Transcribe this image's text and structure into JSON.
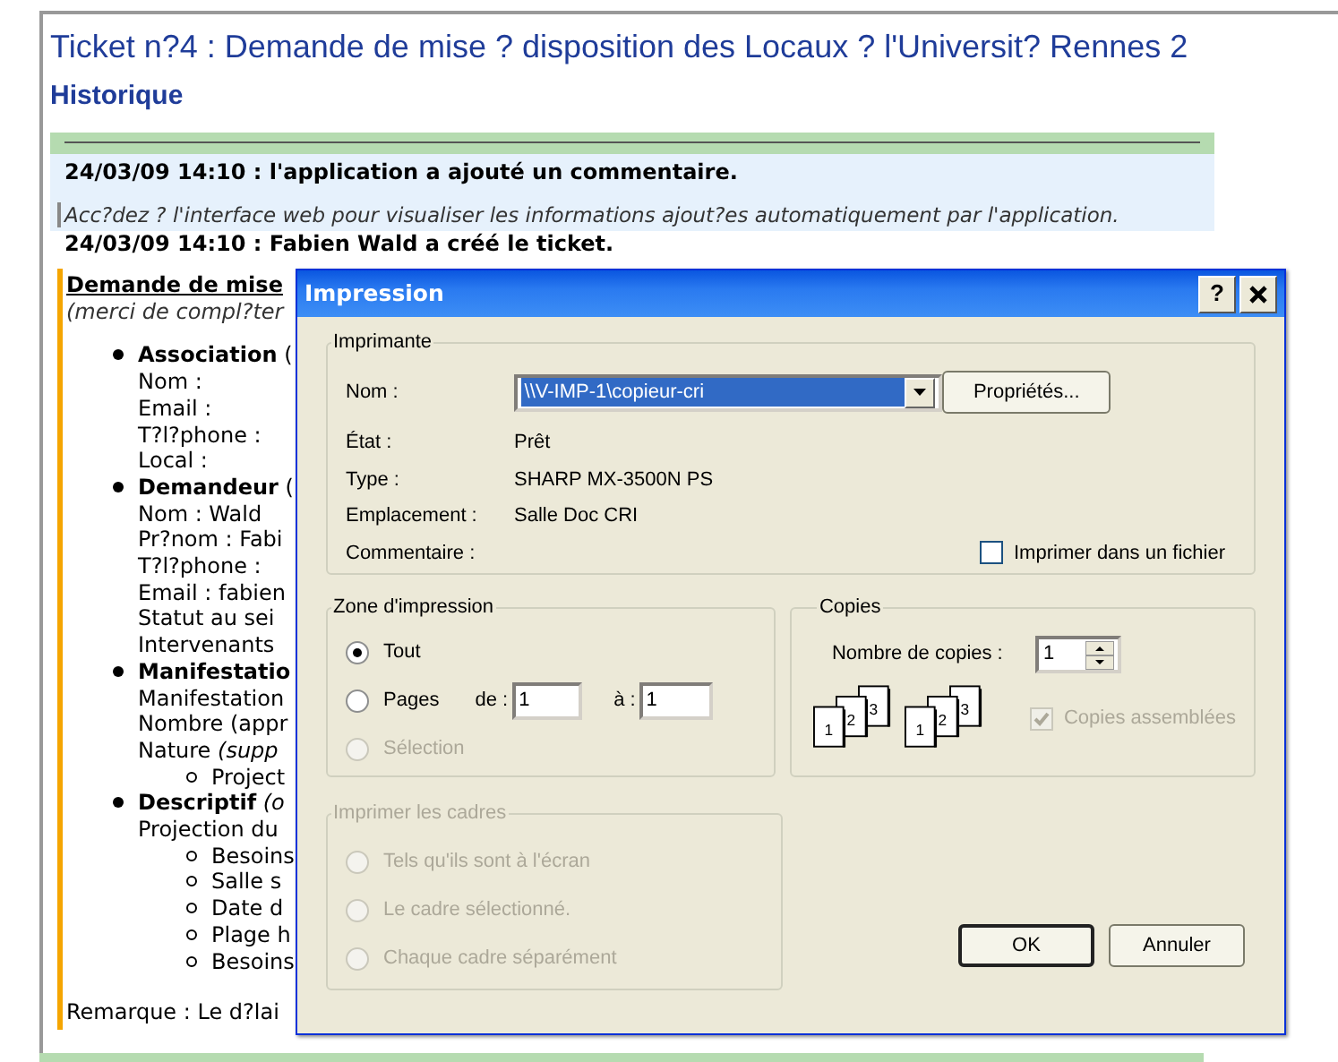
{
  "page": {
    "title": "Ticket n?4 : Demande de mise ? disposition des Locaux ? l'Universit? Rennes 2",
    "section": "Historique",
    "entries": [
      {
        "kind": "comment",
        "heading": "24/03/09 14:10 : l'application a ajouté un commentaire.",
        "text": "Acc?dez ? l'interface web pour visualiser les informations ajout?es automatiquement par l'application."
      },
      {
        "kind": "event",
        "heading": "24/03/09 14:10 : Fabien Wald a créé le ticket."
      }
    ],
    "form": {
      "heading": "Demande de mise",
      "note": "(merci de compl?ter",
      "items": [
        {
          "label": "**Association** (",
          "lines": [
            "Nom :",
            "Email :",
            "T?l?phone :",
            "Local :"
          ]
        },
        {
          "label": "**Demandeur** (",
          "lines": [
            "Nom : Wald",
            "Pr?nom : Fabi",
            "T?l?phone :",
            "Email : fabien",
            "Statut au sei",
            "Intervenants"
          ]
        },
        {
          "label": "**Manifestatio**",
          "lines": [
            "Manifestation",
            "Nombre (appr",
            "Nature *(supp*"
          ],
          "subitems": [
            "Project"
          ]
        },
        {
          "label": "**Descriptif** *(o*",
          "lines": [
            "Projection du"
          ],
          "subitems": [
            "Besoins",
            "Salle s",
            "Date d",
            "Plage h",
            "Besoins"
          ]
        }
      ],
      "remark": "Remarque : Le d?lai"
    }
  },
  "dialog": {
    "title": "Impression",
    "help": "?",
    "printer": {
      "legend": "Imprimante",
      "name_label": "Nom :",
      "name_value": "\\\\V-IMP-1\\copieur-cri",
      "properties_button": "Propriétés...",
      "details": [
        {
          "label": "État :",
          "value": "Prêt"
        },
        {
          "label": "Type :",
          "value": "SHARP MX-3500N PS"
        },
        {
          "label": "Emplacement :",
          "value": "Salle Doc CRI"
        },
        {
          "label": "Commentaire :"
        }
      ],
      "print_to_file": {
        "label": "Imprimer dans un fichier",
        "checked": false
      }
    },
    "range": {
      "legend": "Zone d'impression",
      "options": [
        {
          "label": "Tout",
          "selected": true,
          "disabled": false
        },
        {
          "label": "Pages",
          "selected": false,
          "disabled": false
        },
        {
          "label": "Sélection",
          "selected": false,
          "disabled": true
        }
      ],
      "from_label": "de :",
      "from_value": "1",
      "to_label": "à :",
      "to_value": "1"
    },
    "copies": {
      "legend": "Copies",
      "count_label": "Nombre de copies :",
      "count_value": "1",
      "illustrations": [
        [
          "1",
          "2",
          "3"
        ],
        [
          "1",
          "2",
          "3"
        ]
      ],
      "collate": {
        "label": "Copies assemblées",
        "checked": true,
        "disabled": true
      }
    },
    "frames": {
      "legend": "Imprimer les cadres",
      "disabled": true,
      "options": [
        {
          "label": "Tels qu'ils sont à l'écran",
          "selected": false
        },
        {
          "label": "Le cadre sélectionné.",
          "selected": false
        },
        {
          "label": "Chaque cadre séparément",
          "selected": false
        }
      ]
    },
    "buttons": [
      {
        "label": "OK",
        "kind": "default"
      },
      {
        "label": "Annuler",
        "kind": "normal"
      }
    ]
  }
}
